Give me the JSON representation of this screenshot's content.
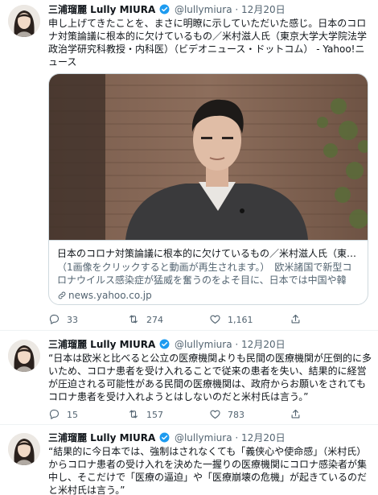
{
  "tweets": [
    {
      "author": "三浦瑠麗 Lully MIURA",
      "handle": "@lullymiura",
      "separator": "·",
      "date": "12月20日",
      "text": "申し上げてきたことを、まさに明瞭に示していただいた感じ。日本のコロナ対策論議に根本的に欠けているもの／米村滋人氏（東京大学大学院法学政治学研究科教授・内科医）（ビデオニュース・ドットコム） - Yahoo!ニュース",
      "card": {
        "title": "日本のコロナ対策論議に根本的に欠けているもの／米村滋人氏（東京...",
        "description": "（1画像をクリックすると動画が再生されます。）　欧米諸国で新型コロナウイルス感染症が猛威を奮うのをよそ目に、日本では中国や韓国...",
        "domain": "news.yahoo.co.jp"
      },
      "stats": {
        "replies": "33",
        "retweets": "274",
        "likes": "1,161"
      }
    },
    {
      "author": "三浦瑠麗 Lully MIURA",
      "handle": "@lullymiura",
      "separator": "·",
      "date": "12月20日",
      "text": "“日本は欧米と比べると公立の医療機関よりも民間の医療機関が圧倒的に多いため、コロナ患者を受け入れることで従来の患者を失い、結果的に経営が圧迫される可能性がある民間の医療機関は、政府からお願いをされてもコロナ患者を受け入れようとはしないのだと米村氏は言う。”",
      "stats": {
        "replies": "15",
        "retweets": "157",
        "likes": "783"
      }
    },
    {
      "author": "三浦瑠麗 Lully MIURA",
      "handle": "@lullymiura",
      "separator": "·",
      "date": "12月20日",
      "text": "“結果的に今日本では、強制はされなくても「義侠心や使命感」（米村氏）からコロナ患者の受け入れを決めた一握りの医療機関にコロナ感染者が集中し、そこだけで「医療の逼迫」や「医療崩壊の危機」が起きているのだと米村氏は言う。”"
    }
  ],
  "colors": {
    "text": "#0f1419",
    "secondary": "#536471",
    "verified": "#1d9bf0",
    "border": "#cfd9de"
  },
  "icons": [
    "verified-badge-icon",
    "reply-icon",
    "retweet-icon",
    "like-icon",
    "share-icon",
    "link-icon"
  ]
}
